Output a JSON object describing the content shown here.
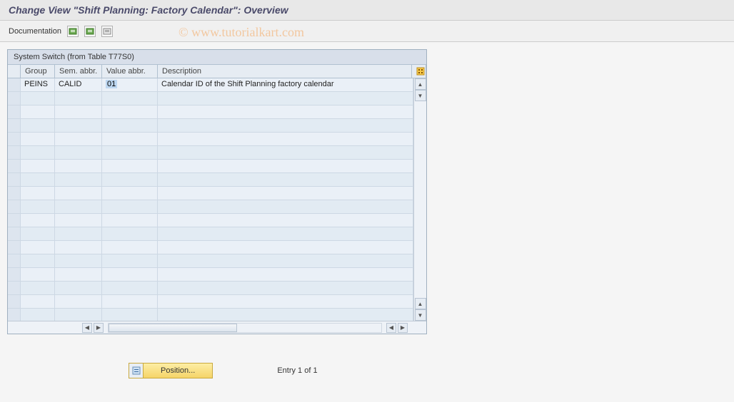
{
  "page": {
    "title": "Change View \"Shift Planning: Factory Calendar\": Overview"
  },
  "toolbar": {
    "documentation_label": "Documentation"
  },
  "watermark": "© www.tutorialkart.com",
  "grid": {
    "title": "System Switch (from Table T77S0)",
    "headers": {
      "group": "Group",
      "sem_abbr": "Sem. abbr.",
      "value_abbr": "Value abbr.",
      "description": "Description"
    },
    "rows": [
      {
        "group": "PEINS",
        "sem_abbr": "CALID",
        "value_abbr": "01",
        "description": "Calendar ID of the Shift Planning factory calendar"
      }
    ]
  },
  "footer": {
    "position_label": "Position...",
    "entry_status": "Entry 1 of 1"
  }
}
